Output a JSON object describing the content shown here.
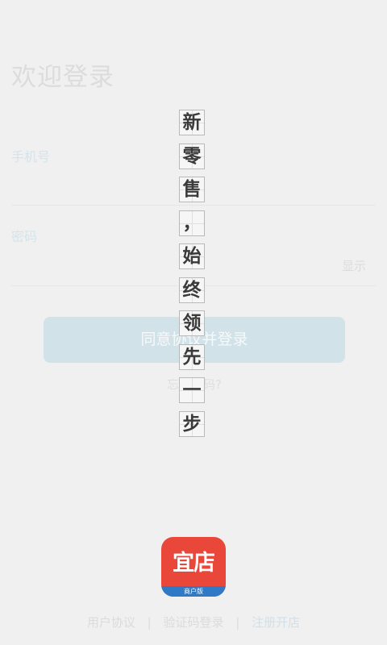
{
  "login": {
    "title": "欢迎登录",
    "phone_label": "手机号",
    "password_label": "密码",
    "show_label": "显示",
    "login_button": "同意协议并登录",
    "forgot_password": "忘记密码?"
  },
  "slogan": {
    "chars": [
      "新",
      "零",
      "售",
      "，",
      "始",
      "终",
      "领",
      "先",
      "一",
      "步"
    ]
  },
  "app_icon": {
    "name": "宜店",
    "edition": "商户版",
    "colors": {
      "top": "#e8473a",
      "band": "#2f79c6"
    }
  },
  "footer": {
    "user_agreement": "用户协议",
    "separator": "|",
    "sms_login": "验证码登录",
    "register_store": "注册开店"
  },
  "colors": {
    "background": "#f0f0f0",
    "button": "#d2e2e9",
    "link_accent": "#cfe0ea"
  }
}
